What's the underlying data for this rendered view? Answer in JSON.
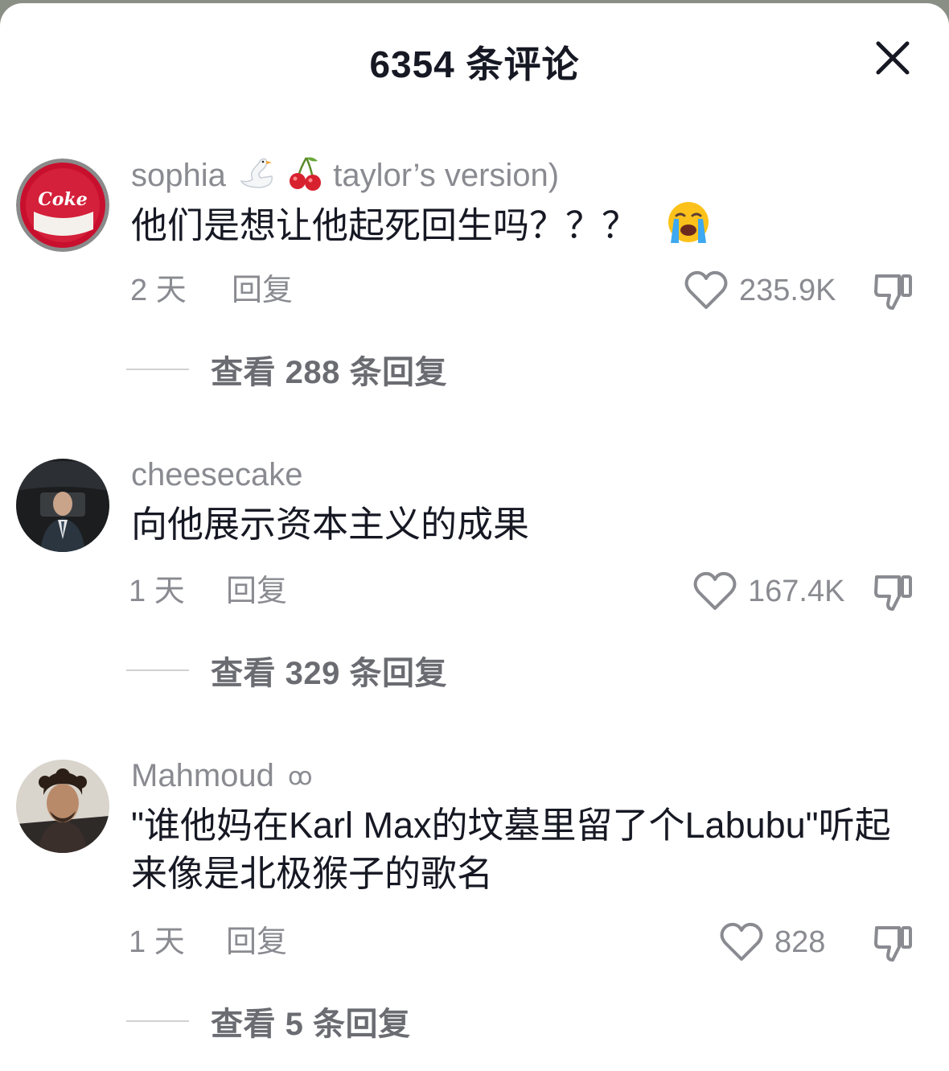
{
  "header": {
    "title": "6354 条评论"
  },
  "comments": [
    {
      "username": "sophia",
      "username_emojis": [
        "swan",
        "cherries"
      ],
      "username_suffix": "taylor’s version)",
      "text": "他们是想让他起死回生吗？？？",
      "text_emoji": "loudly-crying-face",
      "time": "2 天",
      "reply_label": "回复",
      "likes": "235.9K",
      "view_replies": "查看 288 条回复",
      "avatar_text": "Coke"
    },
    {
      "username": "cheesecake",
      "text": "向他展示资本主义的成果",
      "time": "1 天",
      "reply_label": "回复",
      "likes": "167.4K",
      "view_replies": "查看 329 条回复"
    },
    {
      "username": "Mahmoud",
      "username_badge": "ꝏ",
      "text": "\"谁他妈在Karl Max的坟墓里留了个Labubu\"听起来像是北极猴子的歌名",
      "time": "1 天",
      "reply_label": "回复",
      "likes": "828",
      "view_replies": "查看 5 条回复"
    }
  ],
  "colors": {
    "primary_text": "#161823",
    "secondary_text": "#8a8b91",
    "reply_link": "#6b6c72",
    "background": "#ffffff"
  }
}
